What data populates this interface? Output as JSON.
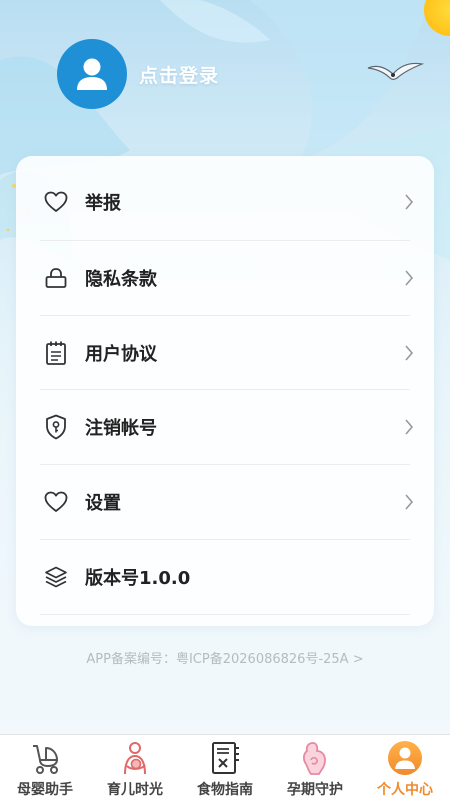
{
  "header": {
    "login_label": "点击登录"
  },
  "menu": {
    "items": [
      {
        "label": "举报",
        "icon": "heart-icon",
        "chevron": true
      },
      {
        "label": "隐私条款",
        "icon": "lock-icon",
        "chevron": true
      },
      {
        "label": "用户协议",
        "icon": "notepad-icon",
        "chevron": true
      },
      {
        "label": "注销帐号",
        "icon": "shield-key-icon",
        "chevron": true
      },
      {
        "label": "设置",
        "icon": "heart-icon",
        "chevron": true
      },
      {
        "label": "版本号1.0.0",
        "icon": "layers-icon",
        "chevron": false
      }
    ]
  },
  "footer": {
    "icp_text": "APP备案编号：粤ICP备2026086826号-25A >"
  },
  "tabbar": {
    "tabs": [
      {
        "label": "母婴助手",
        "icon": "stroller-icon",
        "active": false
      },
      {
        "label": "育儿时光",
        "icon": "mother-baby-icon",
        "active": false
      },
      {
        "label": "食物指南",
        "icon": "food-guide-icon",
        "active": false
      },
      {
        "label": "孕期守护",
        "icon": "pregnancy-icon",
        "active": false
      },
      {
        "label": "个人中心",
        "icon": "profile-icon",
        "active": true
      }
    ]
  },
  "colors": {
    "avatar_bg": "#1f8fd6",
    "active_tab": "#f08a2c",
    "icp_text": "#b4bcc2"
  }
}
